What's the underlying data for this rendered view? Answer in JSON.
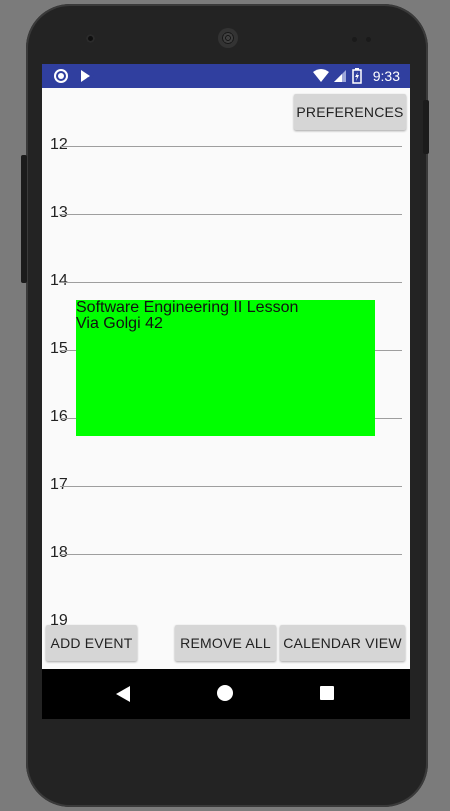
{
  "status_bar": {
    "time": "9:33",
    "color": "#303f9f",
    "left_icons": [
      "circle-icon",
      "play-check-icon"
    ],
    "right_icons": [
      "wifi-icon",
      "signal-icon",
      "battery-icon"
    ]
  },
  "toolbar": {
    "preferences_label": "PREFERENCES"
  },
  "day_view": {
    "hours": [
      "12",
      "13",
      "14",
      "15",
      "16",
      "17",
      "18",
      "19"
    ]
  },
  "event": {
    "title": "Software Engineering II Lesson",
    "location": "Via Golgi 42",
    "color": "#00ff00"
  },
  "bottom_buttons": {
    "add_event": "ADD EVENT",
    "remove_all": "REMOVE ALL",
    "calendar_view": "CALENDAR VIEW"
  },
  "nav_bar": {
    "icons": [
      "back-icon",
      "home-icon",
      "recents-icon"
    ]
  }
}
